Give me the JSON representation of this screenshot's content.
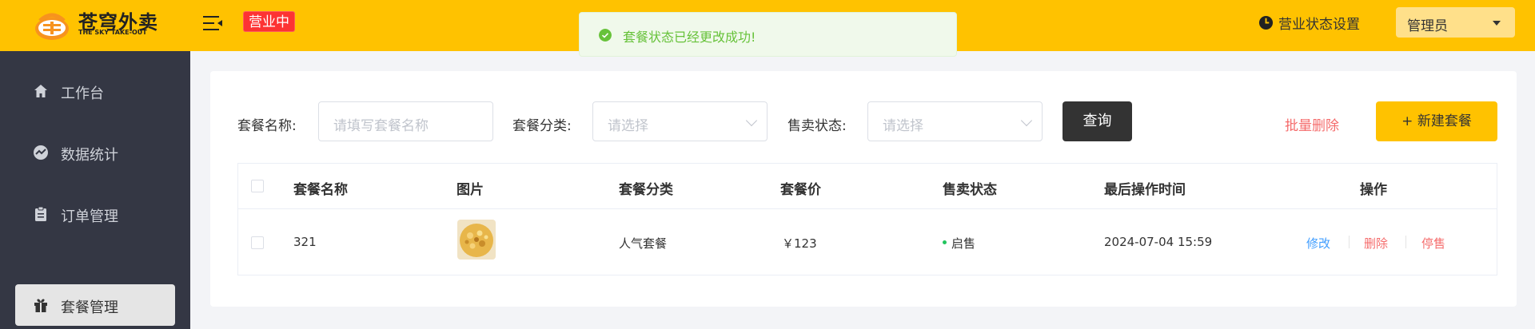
{
  "header": {
    "logo_cn": "苍穹外卖",
    "logo_en": "THE SKY TAKE-OUT",
    "shop_status": "营业中",
    "shop_settings_label": "营业状态设置",
    "user_name": "管理员"
  },
  "toast": {
    "message": "套餐状态已经更改成功!",
    "color": "#67c23a"
  },
  "sidebar": {
    "items": [
      {
        "label": "工作台",
        "icon": "home-icon",
        "active": false
      },
      {
        "label": "数据统计",
        "icon": "chart-icon",
        "active": false
      },
      {
        "label": "订单管理",
        "icon": "clipboard-icon",
        "active": false
      },
      {
        "label": "套餐管理",
        "icon": "gift-icon",
        "active": true
      }
    ]
  },
  "filters": {
    "name_label": "套餐名称:",
    "name_placeholder": "请填写套餐名称",
    "category_label": "套餐分类:",
    "category_placeholder": "请选择",
    "status_label": "售卖状态:",
    "status_placeholder": "请选择",
    "query_button": "查询",
    "batch_delete": "批量删除",
    "new_button": "+ 新建套餐"
  },
  "table": {
    "columns": [
      "套餐名称",
      "图片",
      "套餐分类",
      "套餐价",
      "售卖状态",
      "最后操作时间",
      "操作"
    ],
    "rows": [
      {
        "name": "321",
        "category": "人气套餐",
        "price": "￥123",
        "status": "启售",
        "updated": "2024-07-04 15:59",
        "actions": {
          "edit": "修改",
          "delete": "删除",
          "toggle": "停售"
        }
      }
    ]
  },
  "colors": {
    "brand": "#ffc200",
    "sidebar": "#343744",
    "danger": "#f56c6c",
    "link": "#419eff"
  }
}
